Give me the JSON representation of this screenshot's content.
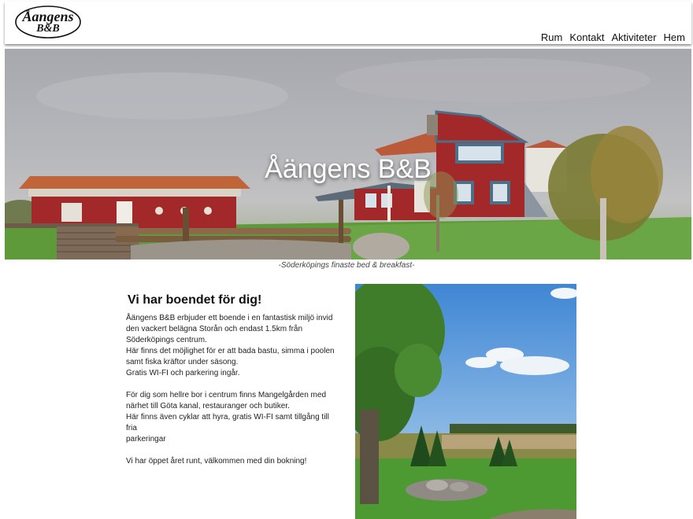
{
  "header": {
    "logo_line1": "Åangens",
    "logo_line2": "B&B",
    "nav": [
      "Rum",
      "Kontakt",
      "Aktiviteter",
      "Hem"
    ]
  },
  "hero": {
    "title": "Åängens B&B"
  },
  "tagline": "-Söderköpings finaste bed & breakfast-",
  "content": {
    "heading": "Vi har boendet för dig!",
    "lines": [
      "Åängens B&B erbjuder ett boende i en fantastisk miljö invid",
      "den vackert belägna Storån och endast 1.5km från",
      "Söderköpings centrum.",
      "Här finns det möjlighet för er att bada bastu, simma i poolen",
      "samt fiska kräftor under säsong.",
      "Gratis WI-FI och parkering ingår.",
      "",
      "För dig som hellre bor i centrum finns Mangelgården med",
      "närhet till Göta kanal, restauranger och butiker.",
      "Här finns även cyklar att hyra, gratis WI-FI samt tillgång till fria",
      "parkeringar",
      "",
      "Vi har öppet året runt, välkommen med din bokning!"
    ]
  },
  "colors": {
    "house_red": "#a3282a",
    "trim_blue": "#4e6f88",
    "grass": "#5f9a3a",
    "sky": "#4b8fd6"
  }
}
